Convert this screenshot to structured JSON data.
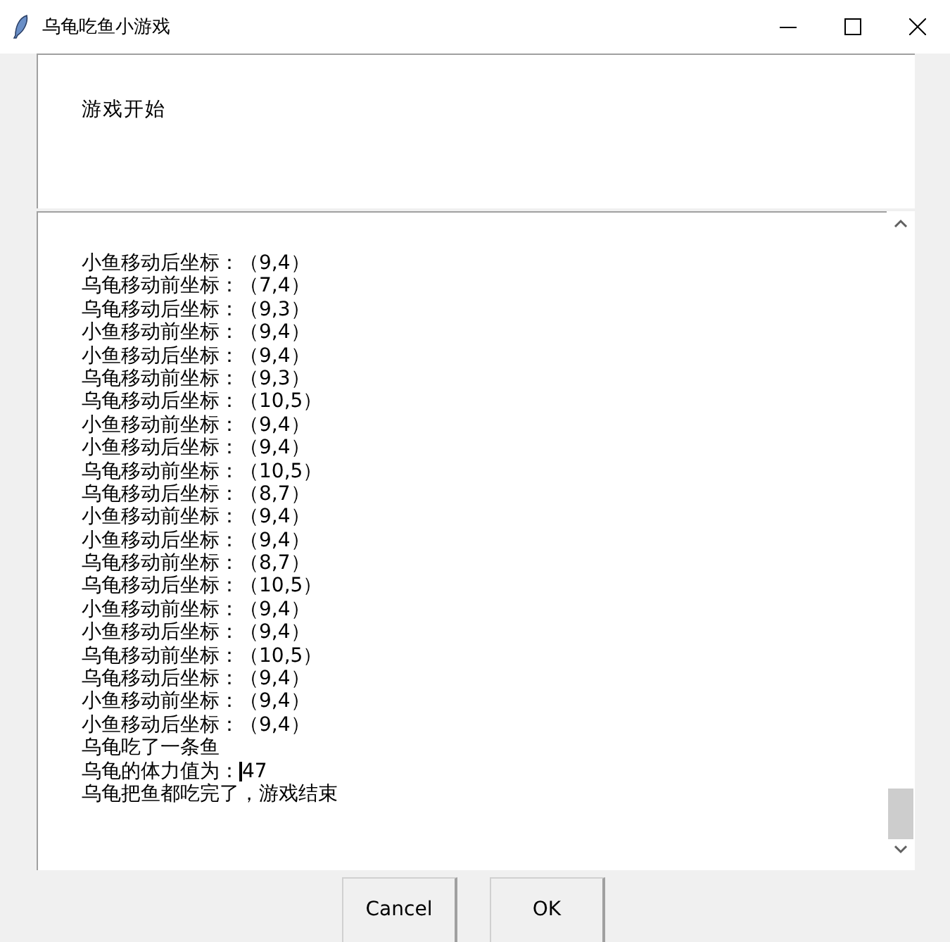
{
  "window": {
    "title": "乌龟吃鱼小游戏"
  },
  "message": "游戏开始",
  "log": [
    {
      "text": "小鱼移动后坐标：（9,4）"
    },
    {
      "text": "乌龟移动前坐标：（7,4）"
    },
    {
      "text": "乌龟移动后坐标：（9,3）"
    },
    {
      "text": "小鱼移动前坐标：（9,4）"
    },
    {
      "text": "小鱼移动后坐标：（9,4）"
    },
    {
      "text": "乌龟移动前坐标：（9,3）"
    },
    {
      "text": "乌龟移动后坐标：（10,5）"
    },
    {
      "text": "小鱼移动前坐标：（9,4）"
    },
    {
      "text": "小鱼移动后坐标：（9,4）"
    },
    {
      "text": "乌龟移动前坐标：（10,5）"
    },
    {
      "text": "乌龟移动后坐标：（8,7）"
    },
    {
      "text": "小鱼移动前坐标：（9,4）"
    },
    {
      "text": "小鱼移动后坐标：（9,4）"
    },
    {
      "text": "乌龟移动前坐标：（8,7）"
    },
    {
      "text": "乌龟移动后坐标：（10,5）"
    },
    {
      "text": "小鱼移动前坐标：（9,4）"
    },
    {
      "text": "小鱼移动后坐标：（9,4）"
    },
    {
      "text": "乌龟移动前坐标：（10,5）"
    },
    {
      "text": "乌龟移动后坐标：（9,4）"
    },
    {
      "text": "小鱼移动前坐标：（9,4）"
    },
    {
      "text": "小鱼移动后坐标：（9,4）"
    },
    {
      "text": "乌龟吃了一条鱼"
    },
    {
      "text": "乌龟的体力值为：",
      "cursor": true,
      "after": "47"
    },
    {
      "text": "乌龟把鱼都吃完了，游戏结束"
    }
  ],
  "buttons": [
    "Cancel",
    "OK"
  ]
}
